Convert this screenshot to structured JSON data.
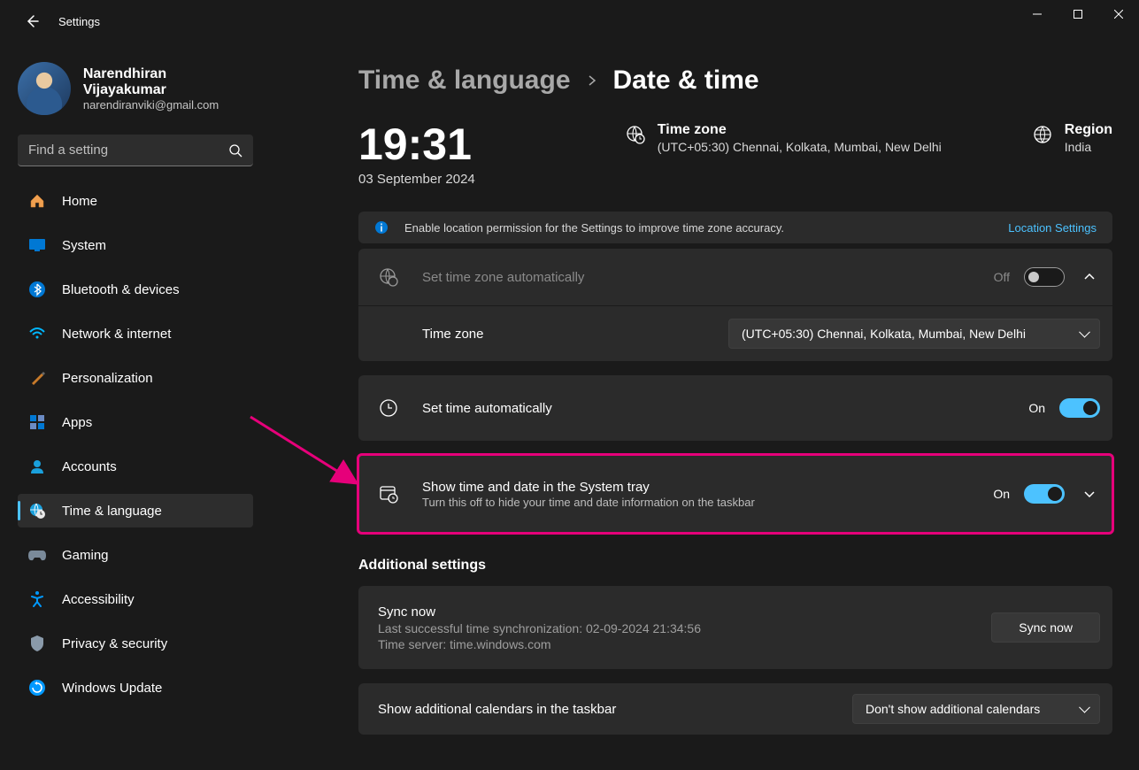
{
  "window": {
    "title": "Settings"
  },
  "user": {
    "name": "Narendhiran Vijayakumar",
    "email": "narendiranviki@gmail.com"
  },
  "search": {
    "placeholder": "Find a setting"
  },
  "nav": {
    "items": [
      {
        "icon": "🏠",
        "label": "Home"
      },
      {
        "icon": "🖥️",
        "label": "System"
      },
      {
        "icon": "bt",
        "label": "Bluetooth & devices"
      },
      {
        "icon": "📶",
        "label": "Network & internet"
      },
      {
        "icon": "🖌️",
        "label": "Personalization"
      },
      {
        "icon": "▦",
        "label": "Apps"
      },
      {
        "icon": "👤",
        "label": "Accounts"
      },
      {
        "icon": "🌐",
        "label": "Time & language"
      },
      {
        "icon": "🎮",
        "label": "Gaming"
      },
      {
        "icon": "♿",
        "label": "Accessibility"
      },
      {
        "icon": "🛡️",
        "label": "Privacy & security"
      },
      {
        "icon": "🔄",
        "label": "Windows Update"
      }
    ],
    "active_index": 7
  },
  "breadcrumb": {
    "parent": "Time & language",
    "current": "Date & time"
  },
  "header": {
    "time": "19:31",
    "date": "03 September 2024",
    "timezone_label": "Time zone",
    "timezone_value": "(UTC+05:30) Chennai, Kolkata, Mumbai, New Delhi",
    "region_label": "Region",
    "region_value": "India"
  },
  "tip": {
    "text": "Enable location permission for the Settings to improve time zone accuracy.",
    "link": "Location Settings"
  },
  "settings": {
    "auto_timezone": {
      "title": "Set time zone automatically",
      "state_label": "Off",
      "on": false,
      "sub_label": "Time zone",
      "sub_value": "(UTC+05:30) Chennai, Kolkata, Mumbai, New Delhi"
    },
    "auto_time": {
      "title": "Set time automatically",
      "state_label": "On",
      "on": true
    },
    "systray": {
      "title": "Show time and date in the System tray",
      "subtitle": "Turn this off to hide your time and date information on the taskbar",
      "state_label": "On",
      "on": true
    }
  },
  "additional": {
    "heading": "Additional settings",
    "sync": {
      "title": "Sync now",
      "last_sync": "Last successful time synchronization: 02-09-2024 21:34:56",
      "server": "Time server: time.windows.com",
      "button": "Sync now"
    },
    "calendars": {
      "title": "Show additional calendars in the taskbar",
      "value": "Don't show additional calendars"
    }
  }
}
